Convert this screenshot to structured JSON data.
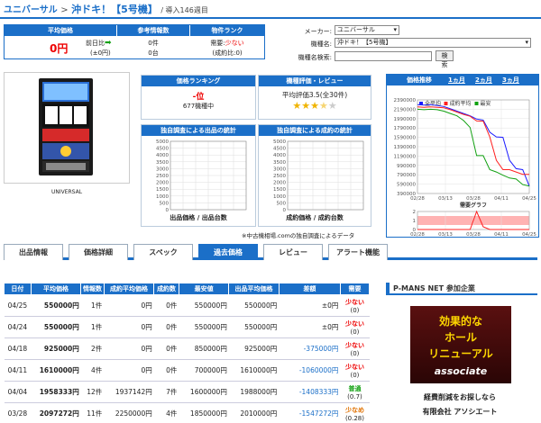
{
  "breadcrumb": {
    "root": "ユニバーサル",
    "sep": ">",
    "title": "沖ドキ！【5号機】",
    "sub": "/ 導入146週目"
  },
  "summary": {
    "h1": "平均価格",
    "h2": "参考情報数",
    "h3": "物件ランク",
    "price": "0円",
    "diff_label": "前日比",
    "diff_value": "(±0円)",
    "info1": "0件",
    "info2": "0台",
    "rank_label1": "需要:",
    "rank_value1": "少ない",
    "rank_label2": "(成約比:0)"
  },
  "filters": {
    "maker_label": "メーカー:",
    "maker_value": "ユニバーサル",
    "model_label": "機種名:",
    "model_value": "沖ドキ！【5号機】",
    "search_label": "機種名検索:",
    "search_value": "",
    "search_button": "検索"
  },
  "machine": {
    "maker": "UNIVERSAL"
  },
  "ranking": {
    "header": "価格ランキング",
    "rank": "-位",
    "count": "677機種中"
  },
  "review": {
    "header": "機種評価・レビュー",
    "text": "平均評価3.5(全30件)",
    "stars": 3.5
  },
  "stat_out": {
    "header": "独自調査による出品の統計",
    "ticks": [
      "5000",
      "4500",
      "4000",
      "3500",
      "3000",
      "2500",
      "2000",
      "1500",
      "1000",
      "500",
      "0"
    ],
    "xlabel": "出品価格 / 出品台数"
  },
  "stat_deal": {
    "header": "独自調査による成約の統計",
    "ticks": [
      "5000",
      "4500",
      "4000",
      "3500",
      "3000",
      "2500",
      "2000",
      "1500",
      "1000",
      "500",
      "0"
    ],
    "xlabel": "成約価格 / 成約台数"
  },
  "stat_note": "※中古機相場.comの独自調査によるデータ",
  "trend": {
    "header": "価格推移",
    "range1": "1ヵ月",
    "range2": "2ヵ月",
    "range3": "3ヵ月",
    "legend": [
      {
        "name": "全平均",
        "color": "#1a1aff"
      },
      {
        "name": "成約平均",
        "color": "#ff2020"
      },
      {
        "name": "最安",
        "color": "#10a010"
      }
    ],
    "demand_label": "需要グラフ"
  },
  "chart_data": [
    {
      "type": "line",
      "title": "価格推移",
      "x": [
        "02/28",
        "03/13",
        "03/28",
        "04/11",
        "04/25"
      ],
      "yticks": [
        2390000,
        2190000,
        1990000,
        1790000,
        1590000,
        1390000,
        1190000,
        990000,
        790000,
        590000,
        390000
      ],
      "ylim": [
        390000,
        2390000
      ],
      "series": [
        {
          "name": "全平均",
          "color": "#1a1aff",
          "values": [
            2290000,
            2280000,
            2290000,
            2270000,
            2250000,
            2200000,
            2150000,
            2100000,
            2050000,
            1980000,
            1960000,
            1700000,
            1600000,
            1590000,
            1100000,
            920000,
            900000,
            550000
          ]
        },
        {
          "name": "成約平均",
          "color": "#ff2020",
          "values": [
            2240000,
            2230000,
            2240000,
            2230000,
            2220000,
            2180000,
            2130000,
            2080000,
            2040000,
            1940000,
            1937000,
            1600000,
            1100000,
            900000,
            900000,
            850000,
            800000,
            800000
          ]
        },
        {
          "name": "最安",
          "color": "#10a010",
          "values": [
            2190000,
            2180000,
            2190000,
            2180000,
            2150000,
            2100000,
            2050000,
            1950000,
            1800000,
            1200000,
            1200000,
            900000,
            850000,
            780000,
            720000,
            700000,
            580000,
            550000
          ]
        }
      ]
    },
    {
      "type": "line",
      "title": "需要グラフ",
      "x": [
        "02/28",
        "03/13",
        "03/28",
        "04/11",
        "04/25"
      ],
      "yticks": [
        2,
        1,
        0
      ],
      "ylim": [
        0,
        2
      ],
      "series": [
        {
          "name": "需要",
          "color": "#ff2020",
          "values": [
            0,
            0,
            0,
            0,
            0,
            0,
            0,
            0,
            0,
            2,
            0.3,
            0,
            0,
            0,
            0,
            0,
            0,
            0
          ]
        }
      ]
    }
  ],
  "tabs": [
    {
      "label": "出品情報",
      "active": false
    },
    {
      "label": "価格詳細",
      "active": false
    },
    {
      "label": "スペック",
      "active": false
    },
    {
      "label": "過去価格",
      "active": true
    },
    {
      "label": "レビュー",
      "active": false
    },
    {
      "label": "アラート機能",
      "active": false
    }
  ],
  "table": {
    "headers": [
      "日付",
      "平均価格",
      "情報数",
      "成約平均価格",
      "成約数",
      "最安値",
      "出品平均価格",
      "差額",
      "需要"
    ],
    "rows": [
      {
        "date": "04/25",
        "avg": "550000円",
        "n": "1件",
        "deal": "0円",
        "dn": "0件",
        "min": "550000円",
        "out": "550000円",
        "diff": "±0円",
        "demand": "少ない",
        "dval": "(0)",
        "dcolor": "#e00",
        "diffneg": false
      },
      {
        "date": "04/24",
        "avg": "550000円",
        "n": "1件",
        "deal": "0円",
        "dn": "0件",
        "min": "550000円",
        "out": "550000円",
        "diff": "±0円",
        "demand": "少ない",
        "dval": "(0)",
        "dcolor": "#e00",
        "diffneg": false
      },
      {
        "date": "04/18",
        "avg": "925000円",
        "n": "2件",
        "deal": "0円",
        "dn": "0件",
        "min": "850000円",
        "out": "925000円",
        "diff": "-375000円",
        "demand": "少ない",
        "dval": "(0)",
        "dcolor": "#e00",
        "diffneg": true
      },
      {
        "date": "04/11",
        "avg": "1610000円",
        "n": "4件",
        "deal": "0円",
        "dn": "0件",
        "min": "700000円",
        "out": "1610000円",
        "diff": "-1060000円",
        "demand": "少ない",
        "dval": "(0)",
        "dcolor": "#e00",
        "diffneg": true
      },
      {
        "date": "04/04",
        "avg": "1958333円",
        "n": "12件",
        "deal": "1937142円",
        "dn": "7件",
        "min": "1600000円",
        "out": "1988000円",
        "diff": "-1408333円",
        "demand": "普通",
        "dval": "(0.7)",
        "dcolor": "#10a010",
        "diffneg": true
      },
      {
        "date": "03/28",
        "avg": "2097272円",
        "n": "11件",
        "deal": "2250000円",
        "dn": "4件",
        "min": "1850000円",
        "out": "2010000円",
        "diff": "-1547272円",
        "demand": "少なめ",
        "dval": "(0.28)",
        "dcolor": "#e07000",
        "diffneg": true
      }
    ]
  },
  "sidebar": {
    "header": "P-MANS NET 参加企業",
    "ad_line1": "効果的な",
    "ad_line2": "ホール",
    "ad_line3": "リニューアル",
    "ad_brand": "associate",
    "caption": "経費削減をお探しなら",
    "company": "有限会社 アソシエート"
  }
}
